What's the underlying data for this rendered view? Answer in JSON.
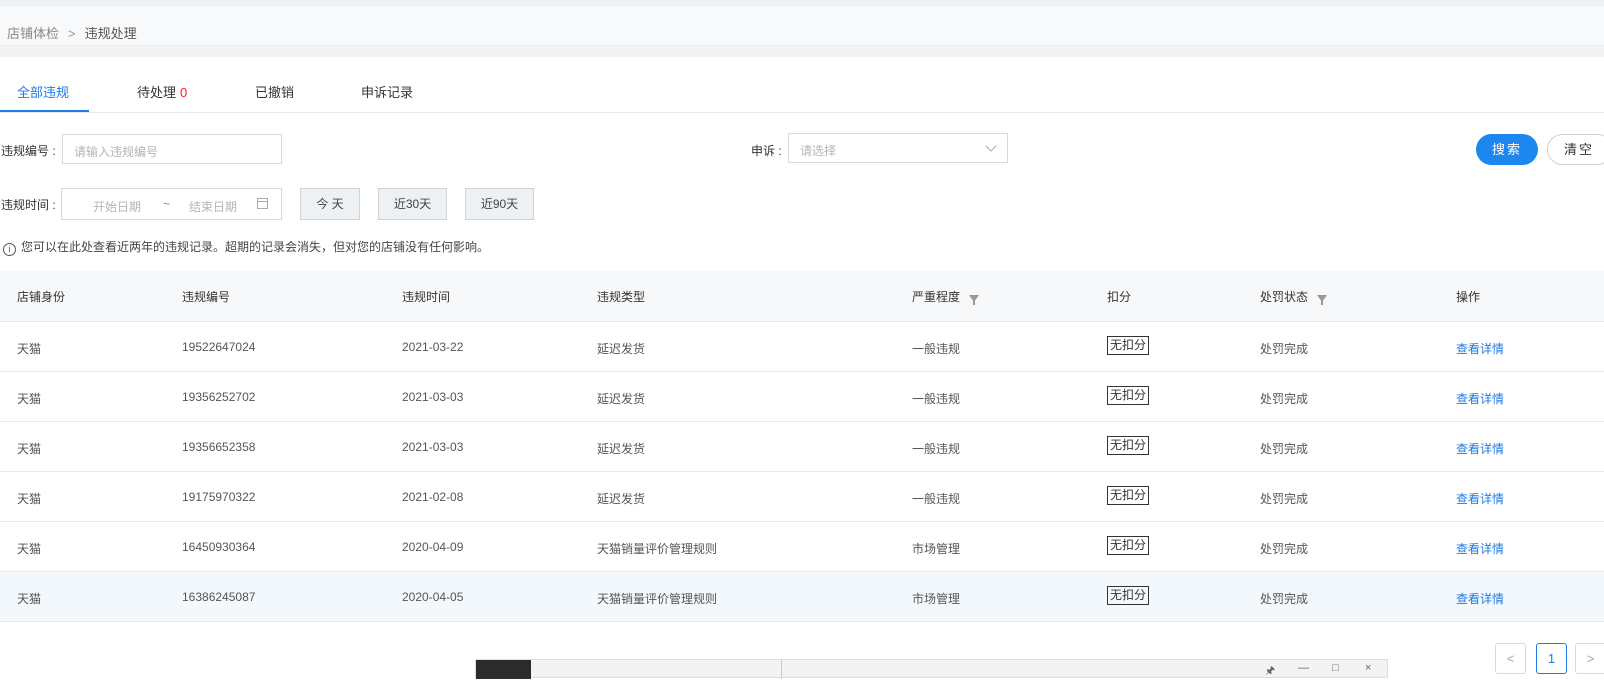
{
  "breadcrumb": {
    "parent": "店铺体检",
    "separator": ">",
    "current": "违规处理"
  },
  "tabs": [
    {
      "label": "全部违规"
    },
    {
      "label": "待处理",
      "count": "0"
    },
    {
      "label": "已撤销"
    },
    {
      "label": "申诉记录"
    }
  ],
  "filters": {
    "violation_no_label": "违规编号 :",
    "violation_no_placeholder": "请输入违规编号",
    "appeal_label": "申诉 :",
    "appeal_placeholder": "请选择",
    "search_button": "搜索",
    "clear_button": "清空",
    "time_label": "违规时间 :",
    "start_placeholder": "开始日期",
    "range_sep": "~",
    "end_placeholder": "结束日期",
    "quick": [
      "今 天",
      "近30天",
      "近90天"
    ]
  },
  "notice": {
    "icon": "i",
    "text": "您可以在此处查看近两年的违规记录。超期的记录会消失，但对您的店铺没有任何影响。"
  },
  "table": {
    "headers": [
      "店铺身份",
      "违规编号",
      "违规时间",
      "违规类型",
      "严重程度",
      "扣分",
      "处罚状态",
      "操作"
    ],
    "rows": [
      [
        "天猫",
        "19522647024",
        "2021-03-22",
        "延迟发货",
        "一般违规",
        "无扣分",
        "处罚完成",
        "查看详情"
      ],
      [
        "天猫",
        "19356252702",
        "2021-03-03",
        "延迟发货",
        "一般违规",
        "无扣分",
        "处罚完成",
        "查看详情"
      ],
      [
        "天猫",
        "19356652358",
        "2021-03-03",
        "延迟发货",
        "一般违规",
        "无扣分",
        "处罚完成",
        "查看详情"
      ],
      [
        "天猫",
        "19175970322",
        "2021-02-08",
        "延迟发货",
        "一般违规",
        "无扣分",
        "处罚完成",
        "查看详情"
      ],
      [
        "天猫",
        "16450930364",
        "2020-04-09",
        "天猫销量评价管理规则",
        "市场管理",
        "无扣分",
        "处罚完成",
        "查看详情"
      ],
      [
        "天猫",
        "16386245087",
        "2020-04-05",
        "天猫销量评价管理规则",
        "市场管理",
        "无扣分",
        "处罚完成",
        "查看详情"
      ]
    ]
  },
  "pagination": {
    "prev": "<",
    "page": "1",
    "next": ">"
  },
  "window_controls": [
    "🖈",
    "—",
    "□",
    "×"
  ],
  "colors": {
    "accent": "#1d7be5",
    "danger": "#f5222d",
    "header_bg": "#f7f8fa",
    "highlight_row": "#f3f8fd"
  }
}
